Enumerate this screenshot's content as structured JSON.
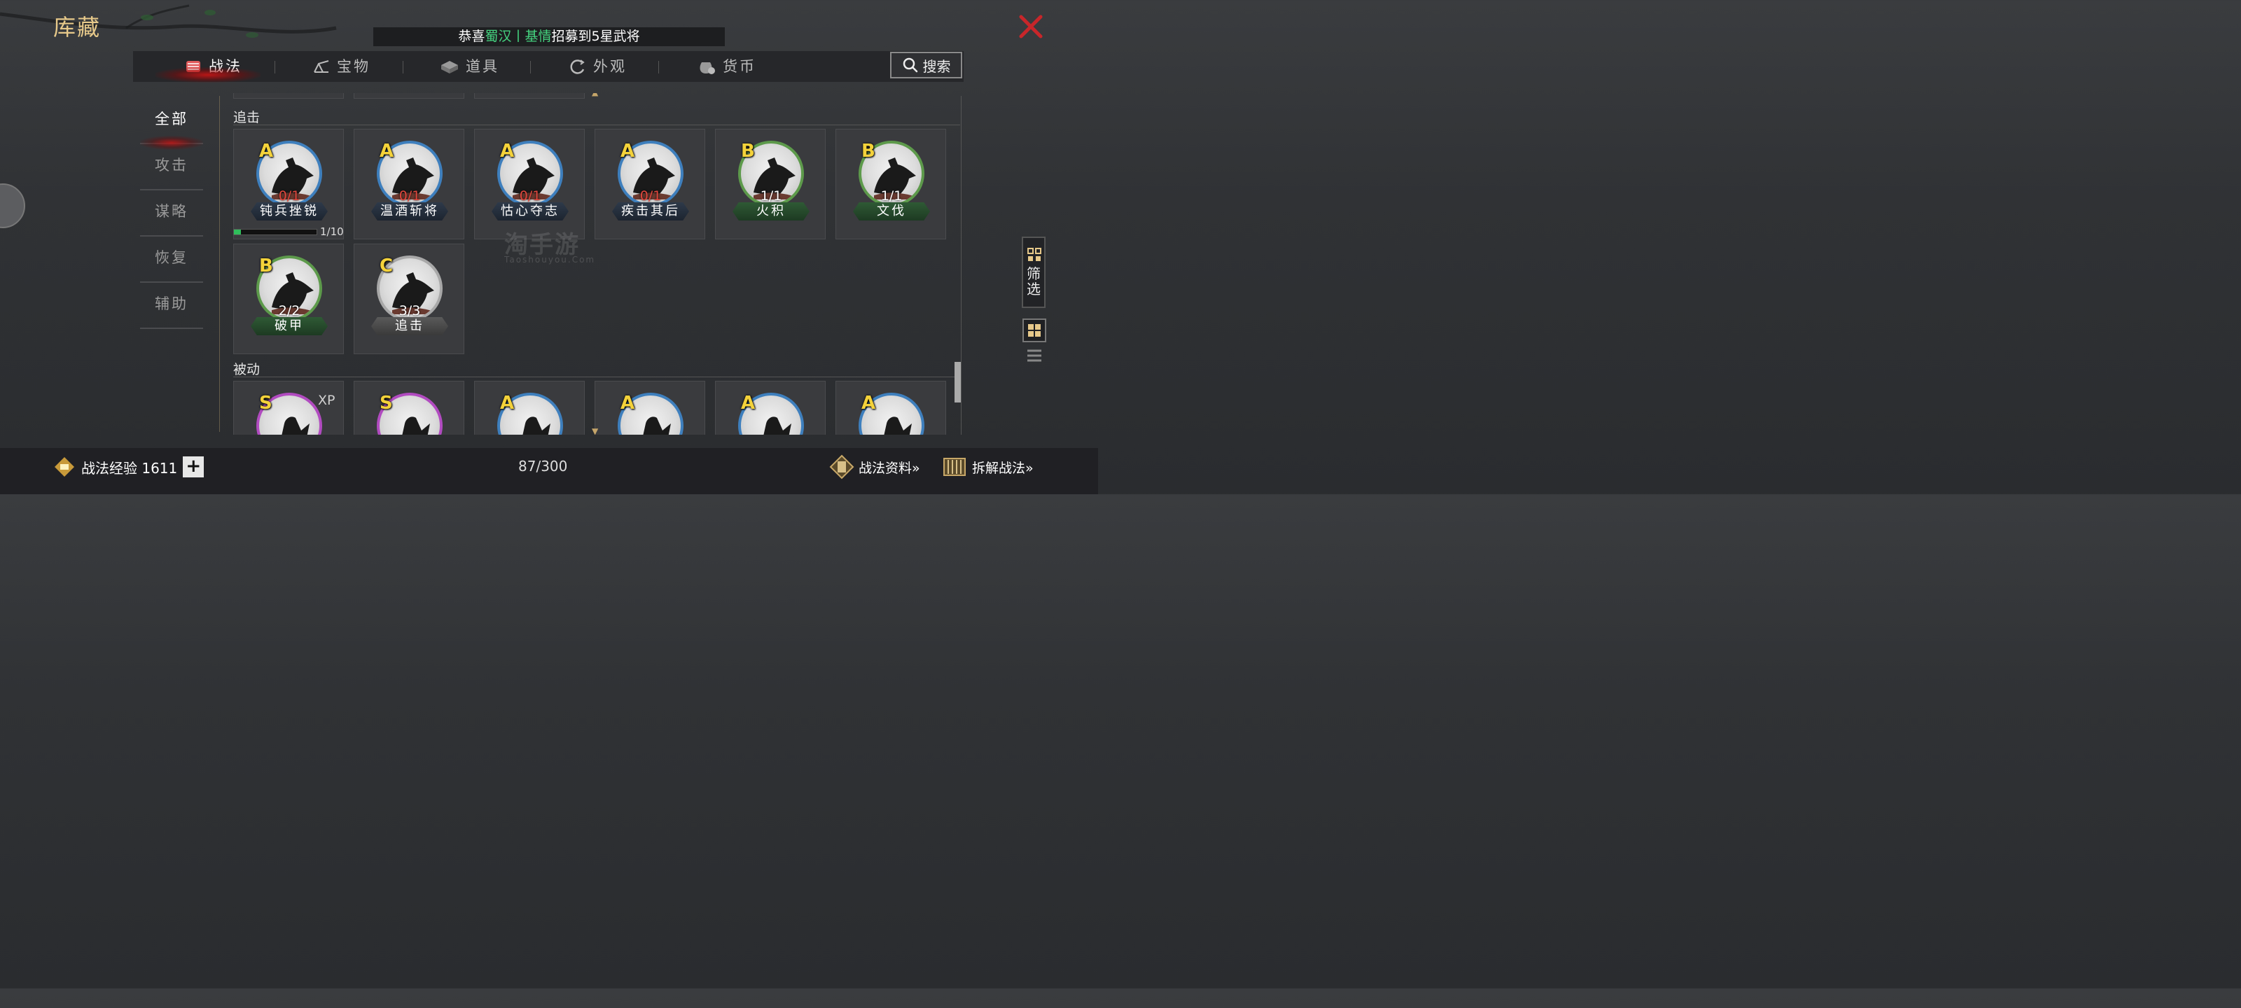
{
  "title": "库藏",
  "announcement": {
    "prefix": "恭喜",
    "faction": "蜀汉",
    "sep": "丨",
    "name": "基情",
    "suffix": "招募到5星武将"
  },
  "tabs": [
    {
      "label": "战法",
      "icon": "strategy-scroll-icon",
      "active": true
    },
    {
      "label": "宝物",
      "icon": "treasure-icon",
      "active": false
    },
    {
      "label": "道具",
      "icon": "item-box-icon",
      "active": false
    },
    {
      "label": "外观",
      "icon": "appearance-icon",
      "active": false
    },
    {
      "label": "货币",
      "icon": "currency-bag-icon",
      "active": false
    }
  ],
  "search": {
    "label": "搜索"
  },
  "left_menu": [
    {
      "label": "全部",
      "active": true
    },
    {
      "label": "攻击",
      "active": false
    },
    {
      "label": "谋略",
      "active": false
    },
    {
      "label": "恢复",
      "active": false
    },
    {
      "label": "辅助",
      "active": false
    }
  ],
  "sections": [
    {
      "title": "追击",
      "cards": [
        {
          "grade": "A",
          "count": "0/1",
          "name": "钝兵挫锐",
          "tier": "blue",
          "count_color": "red",
          "xp": "1/10"
        },
        {
          "grade": "A",
          "count": "0/1",
          "name": "温酒斩将",
          "tier": "blue",
          "count_color": "red"
        },
        {
          "grade": "A",
          "count": "0/1",
          "name": "怙心夺志",
          "tier": "blue",
          "count_color": "red"
        },
        {
          "grade": "A",
          "count": "0/1",
          "name": "疾击其后",
          "tier": "blue",
          "count_color": "red"
        },
        {
          "grade": "B",
          "count": "1/1",
          "name": "火积",
          "tier": "green",
          "count_color": "white"
        },
        {
          "grade": "B",
          "count": "1/1",
          "name": "文伐",
          "tier": "green",
          "count_color": "white"
        },
        {
          "grade": "B",
          "count": "2/2",
          "name": "破甲",
          "tier": "green",
          "count_color": "white"
        },
        {
          "grade": "C",
          "count": "3/3",
          "name": "追击",
          "tier": "grey",
          "count_color": "white"
        }
      ]
    },
    {
      "title": "被动",
      "cards": [
        {
          "grade": "S",
          "tier": "purple",
          "xp_label": "XP"
        },
        {
          "grade": "S",
          "tier": "purple"
        },
        {
          "grade": "A",
          "tier": "blue"
        },
        {
          "grade": "A",
          "tier": "blue"
        },
        {
          "grade": "A",
          "tier": "blue"
        },
        {
          "grade": "A",
          "tier": "blue"
        }
      ]
    }
  ],
  "filter": {
    "label": "筛选"
  },
  "bottom": {
    "exp_label": "战法经验 1611",
    "page_count": "87/300",
    "strategy_info": "战法资料»",
    "dismantle": "拆解战法»"
  },
  "watermark": {
    "main": "淘手游",
    "sub": "Taoshouyou.Com"
  },
  "colors": {
    "gold": "#e7c98a",
    "accent_red": "#c8141e",
    "green": "#45d37f",
    "blue_tier": "#3e7fbd",
    "green_tier": "#5d9a4b",
    "purple_tier": "#b14bc0"
  }
}
